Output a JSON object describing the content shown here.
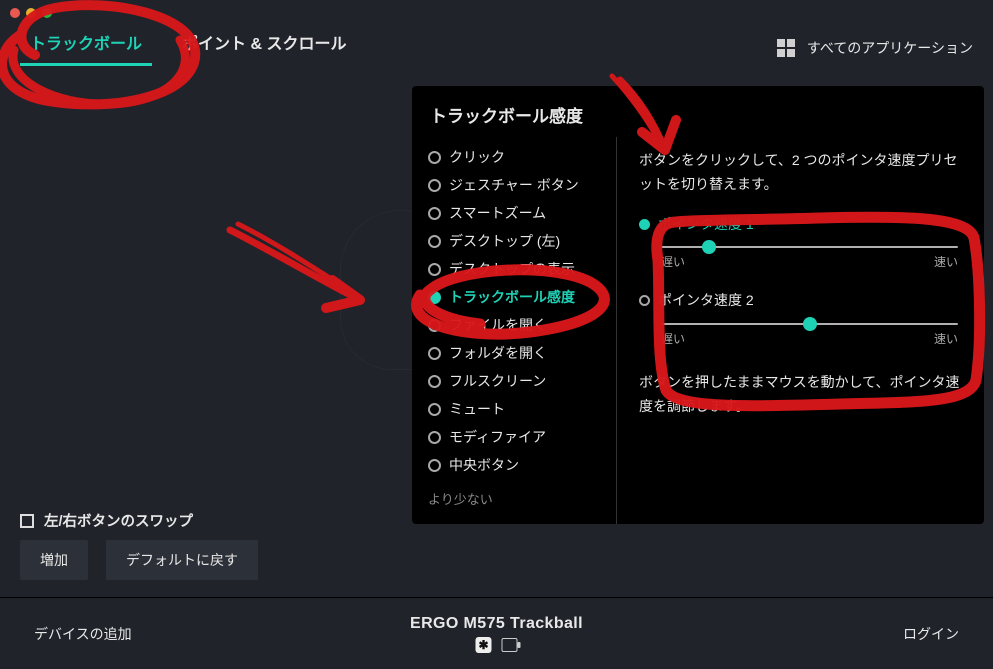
{
  "tabs": {
    "trackball": "トラックボール",
    "point_scroll": "ポイント & スクロール"
  },
  "apps_button": "すべてのアプリケーション",
  "panel": {
    "title": "トラックボール感度",
    "actions": [
      "クリック",
      "ジェスチャー ボタン",
      "スマートズーム",
      "デスクトップ (左)",
      "デスクトップの表示",
      "トラックボール感度",
      "ファイルを開く",
      "フォルダを開く",
      "フルスクリーン",
      "ミュート",
      "モディファイア",
      "中央ボタン"
    ],
    "selected_index": 5,
    "less": "より少ない",
    "intro": "ボタンをクリックして、2 つのポインタ速度プリセットを切り替えます。",
    "speed1": {
      "label": "ポインタ速度 1",
      "pos_pct": 16,
      "slow": "遅い",
      "fast": "速い"
    },
    "speed2": {
      "label": "ポインタ速度 2",
      "pos_pct": 50,
      "slow": "遅い",
      "fast": "速い"
    },
    "note": "ボタンを押したままマウスを動かして、ポインタ速度を調節します。"
  },
  "swap_label": "左/右ボタンのスワップ",
  "buttons": {
    "add": "増加",
    "reset": "デフォルトに戻す"
  },
  "footer": {
    "add_device": "デバイスの追加",
    "device": "ERGO M575 Trackball",
    "login": "ログイン"
  },
  "annot_color": "#d8171a"
}
